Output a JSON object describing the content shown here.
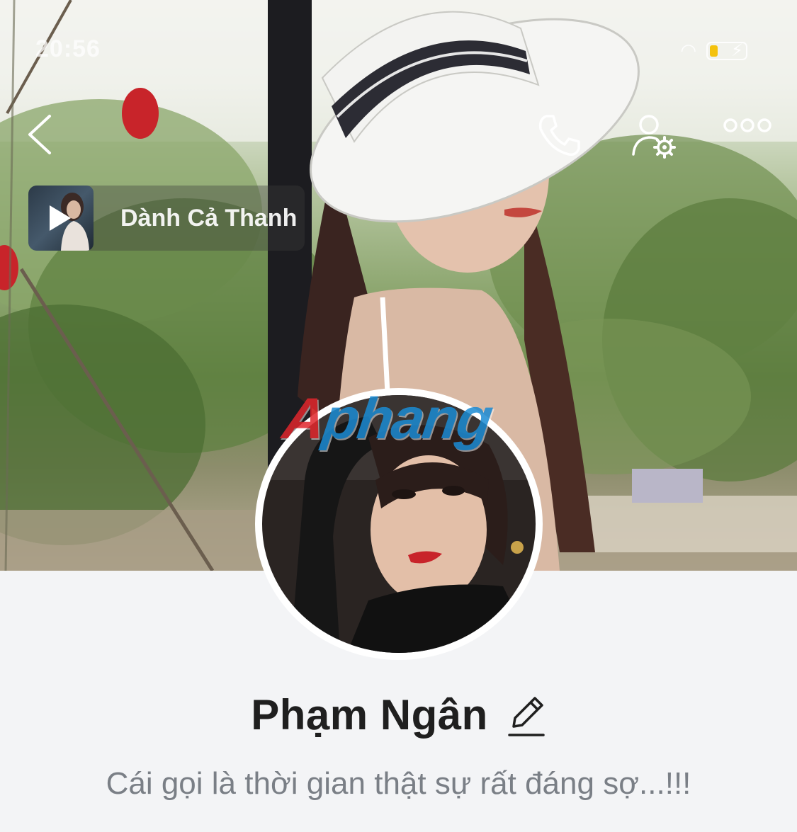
{
  "status_bar": {
    "time": "20:56",
    "battery_level": 0.22,
    "battery_color": "#f4c20d"
  },
  "nav": {
    "back_icon": "chevron-left-icon",
    "call_icon": "phone-icon",
    "settings_icon": "user-settings-icon",
    "more_icon": "more-horizontal-icon"
  },
  "music": {
    "title": "Dành Cả Thanh"
  },
  "watermark": {
    "first": "A",
    "rest": "phang"
  },
  "profile": {
    "name": "Phạm Ngân",
    "status": "Cái gọi là thời gian thật sự rất đáng sợ...!!!"
  },
  "colors": {
    "background": "#f3f4f6",
    "name": "#1f1f1f",
    "status": "#7a7f86"
  }
}
